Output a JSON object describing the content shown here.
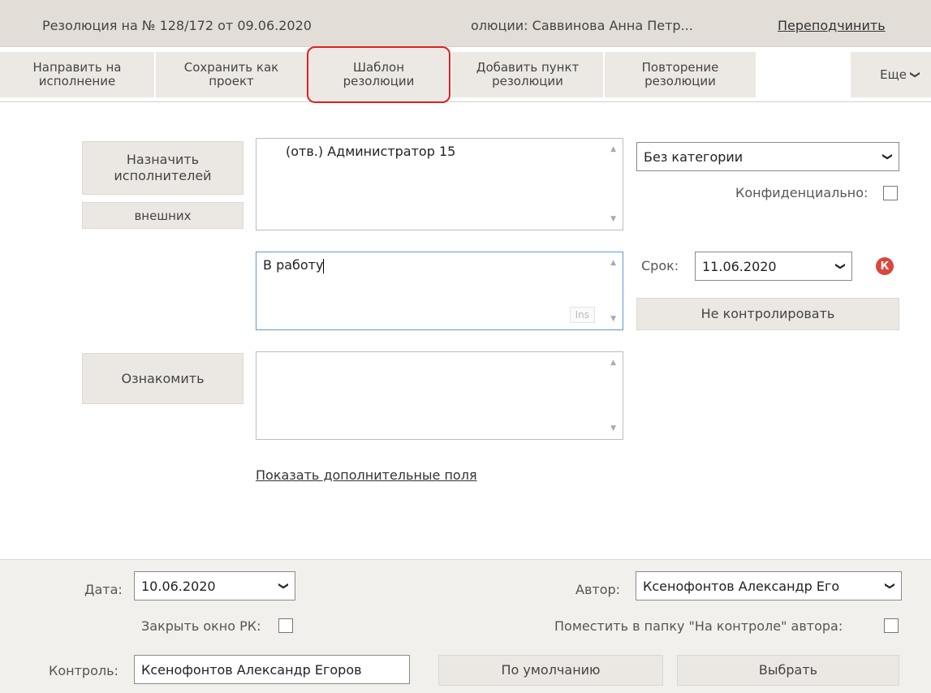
{
  "header": {
    "title": "Резолюция на № 128/172 от 09.06.2020",
    "subtitle": "олюции: Саввинова Анна Петр...",
    "reassign_link": "Переподчинить"
  },
  "toolbar": {
    "buttons": [
      {
        "label": "Направить на\nисполнение"
      },
      {
        "label": "Сохранить как\nпроект"
      },
      {
        "label": "Шаблон\nрезолюции"
      },
      {
        "label": "Добавить пункт\nрезолюции"
      },
      {
        "label": "Повторение\nрезолюции"
      }
    ],
    "more_label": "Еще"
  },
  "form": {
    "assign_button": "Назначить\nисполнителей",
    "external_button": "внешних",
    "executors_text": "(отв.)  Администратор 15",
    "category_select": "Без категории",
    "confidential_label": "Конфиденциально:",
    "confidential_checked": false,
    "resolution_text": "В работу",
    "ins_badge": "Ins",
    "deadline_label": "Срок:",
    "deadline_value": "11.06.2020",
    "control_badge": "К",
    "no_control_button": "Не контролировать",
    "familiarize_button": "Ознакомить",
    "familiarize_text": "",
    "show_more_link": "Показать дополнительные поля"
  },
  "bottom": {
    "date_label": "Дата:",
    "date_value": "10.06.2020",
    "author_label": "Автор:",
    "author_value": "Ксенофонтов Александр Его",
    "close_rk_label": "Закрыть окно РК:",
    "close_rk_checked": false,
    "put_in_folder_label": "Поместить в папку \"На контроле\" автора:",
    "put_in_folder_checked": false,
    "control_label": "Контроль:",
    "control_value": "Ксенофонтов Александр Егоров",
    "default_button": "По умолчанию",
    "choose_button": "Выбрать"
  },
  "colors": {
    "highlight_border": "#e02020",
    "focus_border": "#5b9bd5",
    "control_badge": "#d9473f"
  }
}
